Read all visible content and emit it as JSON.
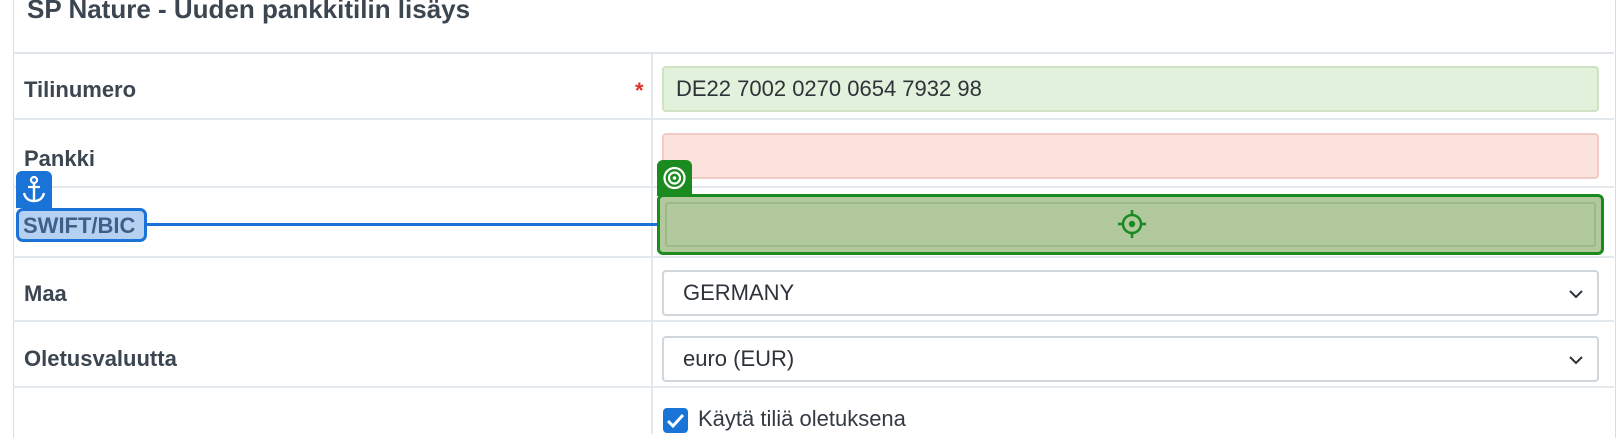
{
  "form": {
    "title": "SP Nature - Uuden pankkitilin lisäys",
    "required_marker": "*",
    "fields": {
      "account_number": {
        "label": "Tilinumero",
        "value": "DE22 7002 0270 0654 7932 98",
        "status": "valid"
      },
      "bank": {
        "label": "Pankki",
        "value": "",
        "status": "invalid"
      },
      "swift": {
        "label": "SWIFT/BIC",
        "value": ""
      },
      "country": {
        "label": "Maa",
        "selected": "GERMANY"
      },
      "currency": {
        "label": "Oletusvaluutta",
        "selected": "euro (EUR)"
      },
      "default_account": {
        "label": "Käytä tiliä oletuksena",
        "checked": true
      }
    }
  },
  "overlay": {
    "anchor_icon": "anchor-icon",
    "target_icon": "target-icon",
    "crosshair_icon": "crosshair-icon",
    "anchor_color": "#1a73d6",
    "target_color": "#1b8a1f"
  },
  "colors": {
    "valid_bg": "#e2f1db",
    "invalid_bg": "#fbe2dd",
    "checkbox": "#1a73d6",
    "required": "#e0322d"
  }
}
